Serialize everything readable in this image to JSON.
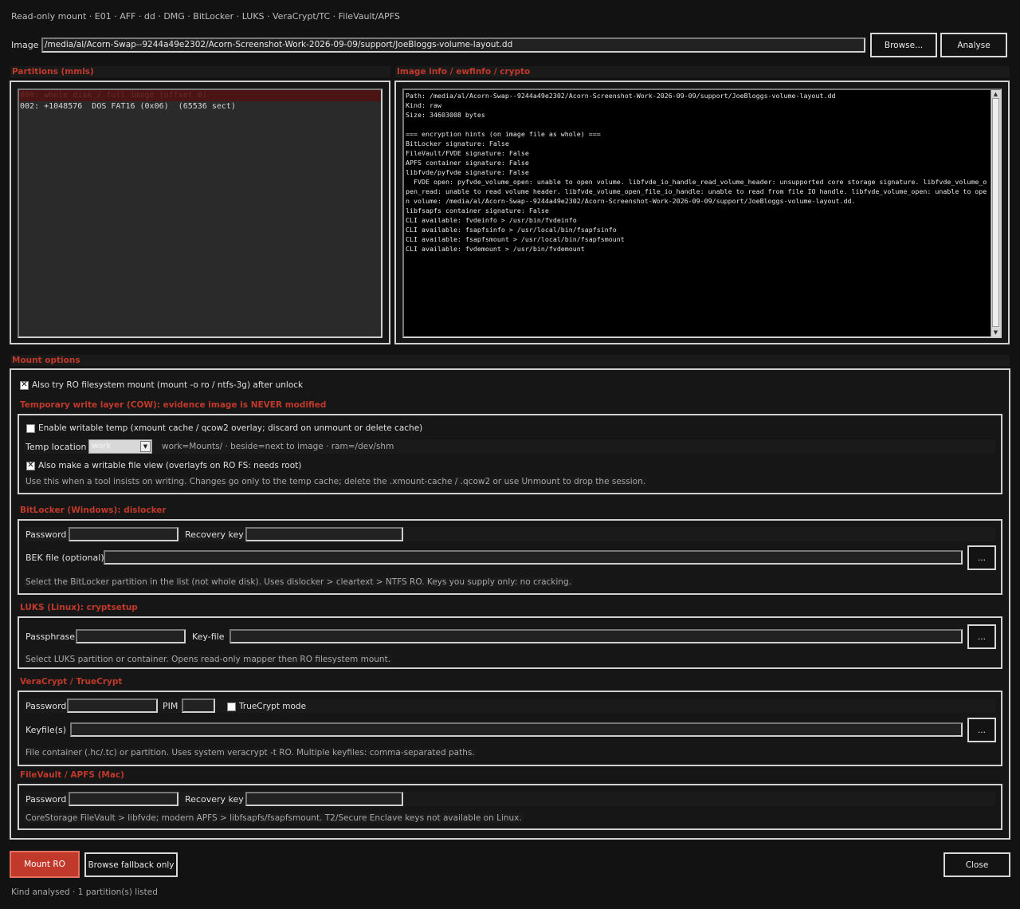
{
  "subtitle": "Read-only mount · E01 · AFF · dd · DMG · BitLocker · LUKS · VeraCrypt/TC · FileVault/APFS",
  "image": {
    "label": "Image",
    "path": "/media/al/Acorn-Swap--9244a49e2302/Acorn-Screenshot-Work-2026-09-09/support/JoeBloggs-volume-layout.dd",
    "browse_label": "Browse...",
    "analyse_label": "Analyse"
  },
  "partitions": {
    "header": "Partitions (mmls)",
    "items": [
      "000: whole disk / full image (offset 0)",
      "002: +1048576  DOS FAT16 (0x06)  (65536 sect)"
    ],
    "selected_index": 0
  },
  "info": {
    "header": "Image info / ewfinfo / crypto",
    "text": "Path: /media/al/Acorn-Swap--9244a49e2302/Acorn-Screenshot-Work-2026-09-09/support/JoeBloggs-volume-layout.dd\nKind: raw\nSize: 34603008 bytes\n\n=== encryption hints (on image file as whole) ===\nBitLocker signature: False\nFileVault/FVDE signature: False\nAPFS container signature: False\nlibfvde/pyfvde signature: False\n  FVDE open: pyfvde_volume_open: unable to open volume. libfvde_io_handle_read_volume_header: unsupported core storage signature. libfvde_volume_open_read: unable to read volume header. libfvde_volume_open_file_io_handle: unable to read from file IO handle. libfvde_volume_open: unable to open volume: /media/al/Acorn-Swap--9244a49e2302/Acorn-Screenshot-Work-2026-09-09/support/JoeBloggs-volume-layout.dd.\nlibfsapfs container signature: False\nCLI available: fvdeinfo > /usr/bin/fvdeinfo\nCLI available: fsapfsinfo > /usr/local/bin/fsapfsinfo\nCLI available: fsapfsmount > /usr/local/bin/fsapfsmount\nCLI available: fvdemount > /usr/bin/fvdemount"
  },
  "mount_options": {
    "header": "Mount options",
    "ro_fs_label": "Also try RO filesystem mount (mount -o ro / ntfs-3g) after unlock",
    "ro_fs_checked": true
  },
  "cow": {
    "header": "Temporary write layer (COW): evidence image is NEVER modified",
    "enable_label": "Enable writable temp (xmount cache / qcow2 overlay; discard on unmount or delete cache)",
    "enable_checked": false,
    "temp_location_label": "Temp location",
    "temp_location_value": "work",
    "temp_location_hint": "work=Mounts/ · beside=next to image · ram=/dev/shm",
    "overlay_label": "Also make a writable file view (overlayfs on RO FS: needs root)",
    "overlay_checked": true,
    "note": "Use this when a tool insists on writing. Changes go only to the temp cache; delete the .xmount-cache / .qcow2 or use Unmount to drop the session."
  },
  "bitlocker": {
    "header": "BitLocker (Windows): dislocker",
    "password_label": "Password",
    "recovery_label": "Recovery key",
    "bek_label": "BEK file (optional)",
    "browse_label": "...",
    "note": "Select the BitLocker partition in the list (not whole disk). Uses dislocker > cleartext > NTFS RO. Keys you supply only: no cracking."
  },
  "luks": {
    "header": "LUKS (Linux): cryptsetup",
    "passphrase_label": "Passphrase",
    "keyfile_label": "Key-file",
    "browse_label": "...",
    "note": "Select LUKS partition or container. Opens read-only mapper then RO filesystem mount."
  },
  "veracrypt": {
    "header": "VeraCrypt / TrueCrypt",
    "password_label": "Password",
    "pim_label": "PIM",
    "truecrypt_label": "TrueCrypt mode",
    "truecrypt_checked": false,
    "keyfiles_label": "Keyfile(s)",
    "browse_label": "...",
    "note": "File container (.hc/.tc) or partition. Uses system veracrypt -t RO. Multiple keyfiles: comma-separated paths."
  },
  "filevault": {
    "header": "FileVault / APFS (Mac)",
    "password_label": "Password",
    "recovery_label": "Recovery key",
    "note": "CoreStorage FileVault > libfvde; modern APFS > libfsapfs/fsapfsmount. T2/Secure Enclave keys not available on Linux."
  },
  "footer": {
    "mount_label": "Mount RO",
    "fallback_label": "Browse fallback only",
    "close_label": "Close",
    "status": "Kind analysed · 1 partition(s) listed"
  },
  "colors": {
    "accent": "#c0392b",
    "background": "#121212",
    "selection": "#4a1414"
  },
  "icons": {
    "checked": "check-x-icon",
    "dropdown": "chevron-down-icon",
    "scroll_up": "scroll-up-arrow-icon",
    "scroll_down": "scroll-down-arrow-icon"
  }
}
